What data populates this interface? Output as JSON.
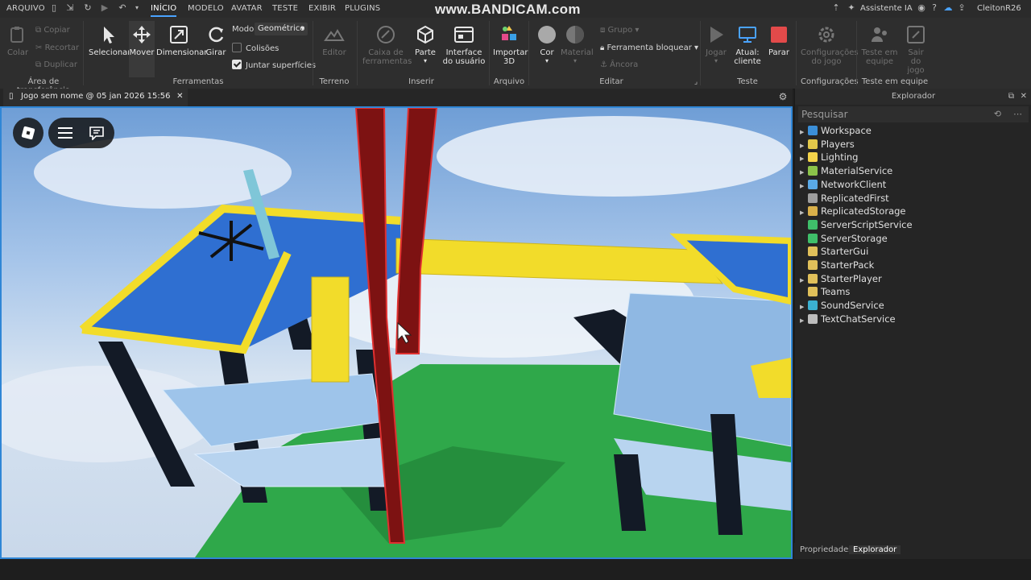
{
  "menubar": {
    "items": [
      "ARQUIVO",
      "INÍCIO",
      "MODELO",
      "AVATAR",
      "TESTE",
      "EXIBIR",
      "PLUGINS"
    ],
    "watermark": "www.BANDICAM.com",
    "ai_assistant": "Assistente IA",
    "username": "CleitonR26"
  },
  "ribbon": {
    "clipboard": {
      "paste": "Colar",
      "copy": "Copiar",
      "cut": "Recortar",
      "duplicate": "Duplicar",
      "label": "Área de transferência"
    },
    "tools": {
      "select": "Selecionar",
      "move": "Mover",
      "scale": "Dimensionar",
      "rotate": "Girar",
      "mode_label": "Modo:",
      "mode_value": "Geométrico",
      "collisions": "Colisões",
      "join_surfaces": "Juntar superfícies",
      "label": "Ferramentas"
    },
    "terrain": {
      "editor": "Editor",
      "label": "Terreno"
    },
    "insert": {
      "toolbox": "Caixa de ferramentas",
      "part": "Parte",
      "ui": "Interface do usuário",
      "label": "Inserir"
    },
    "file": {
      "import3d": "Importar 3D",
      "label": "Arquivo"
    },
    "edit": {
      "color": "Cor",
      "material": "Material",
      "group": "Grupo",
      "lock_tool": "Ferramenta bloquear",
      "anchor": "Âncora",
      "label": "Editar"
    },
    "test": {
      "play": "Jogar",
      "current_client": "Atual: cliente",
      "stop": "Parar",
      "label": "Teste"
    },
    "settings": {
      "game_settings": "Configurações do jogo",
      "label": "Configurações"
    },
    "team_test": {
      "team_test": "Teste em equipe",
      "exit_game": "Sair do jogo",
      "label": "Teste em equipe"
    }
  },
  "document_tab": {
    "title": "Jogo sem nome @ 05 jan 2026 15:56"
  },
  "explorer": {
    "title": "Explorador",
    "search_placeholder": "Pesquisar",
    "items": [
      {
        "name": "Workspace",
        "icon": "globe-icon",
        "color": "#3b8fd8",
        "expand": true
      },
      {
        "name": "Players",
        "icon": "players-icon",
        "color": "#e2c84a",
        "expand": true
      },
      {
        "name": "Lighting",
        "icon": "lightbulb-icon",
        "color": "#f3d34a",
        "expand": true
      },
      {
        "name": "MaterialService",
        "icon": "material-icon",
        "color": "#8bc34a",
        "expand": true
      },
      {
        "name": "NetworkClient",
        "icon": "network-icon",
        "color": "#5aa9e6",
        "expand": true
      },
      {
        "name": "ReplicatedFirst",
        "icon": "replicated-first-icon",
        "color": "#9e9e9e",
        "expand": false
      },
      {
        "name": "ReplicatedStorage",
        "icon": "replicated-storage-icon",
        "color": "#d9b04a",
        "expand": true
      },
      {
        "name": "ServerScriptService",
        "icon": "server-script-icon",
        "color": "#3fbf6a",
        "expand": false
      },
      {
        "name": "ServerStorage",
        "icon": "server-storage-icon",
        "color": "#3fbf6a",
        "expand": false
      },
      {
        "name": "StarterGui",
        "icon": "starter-gui-icon",
        "color": "#e0c05a",
        "expand": false
      },
      {
        "name": "StarterPack",
        "icon": "starter-pack-icon",
        "color": "#e0c05a",
        "expand": false
      },
      {
        "name": "StarterPlayer",
        "icon": "starter-player-icon",
        "color": "#e0c05a",
        "expand": true
      },
      {
        "name": "Teams",
        "icon": "teams-icon",
        "color": "#e0c05a",
        "expand": false
      },
      {
        "name": "SoundService",
        "icon": "sound-icon",
        "color": "#3bb0d0",
        "expand": true
      },
      {
        "name": "TextChatService",
        "icon": "text-chat-icon",
        "color": "#bdbdbd",
        "expand": true
      }
    ]
  },
  "bottom_tabs": {
    "properties": "Propriedades",
    "explorer": "Explorador"
  },
  "colors": {
    "accent": "#2f86d6",
    "stop_red": "#e34a4a",
    "bridge_yellow": "#f2dc2a",
    "pad_blue": "#2f6fd1",
    "baseplate_green": "#2fa84a"
  }
}
